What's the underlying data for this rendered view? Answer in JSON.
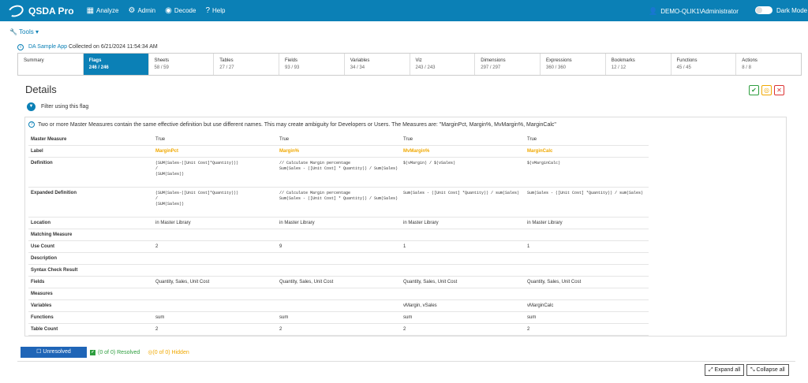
{
  "brand": {
    "title": "QSDA Pro"
  },
  "nav": [
    {
      "label": "Analyze",
      "icon": "grid-icon"
    },
    {
      "label": "Admin",
      "icon": "gear-icon"
    },
    {
      "label": "Decode",
      "icon": "eye-icon"
    },
    {
      "label": "Help",
      "icon": "question-icon"
    }
  ],
  "user": {
    "label": "DEMO-QLIK1\\Administrator"
  },
  "dark_mode": {
    "label": "Dark Mode"
  },
  "tools": {
    "label": "Tools ▾"
  },
  "app": {
    "name": "DA Sample App",
    "collected": " Collected on 6/21/2024 11:54:34 AM"
  },
  "tabs": [
    {
      "name": "Summary",
      "count": ""
    },
    {
      "name": "Flags",
      "count": "246 / 246"
    },
    {
      "name": "Sheets",
      "count": "58 / 59"
    },
    {
      "name": "Tables",
      "count": "27 / 27"
    },
    {
      "name": "Fields",
      "count": "93 / 93"
    },
    {
      "name": "Variables",
      "count": "34 / 34"
    },
    {
      "name": "Viz",
      "count": "243 / 243"
    },
    {
      "name": "Dimensions",
      "count": "297 / 297"
    },
    {
      "name": "Expressions",
      "count": "360 / 360"
    },
    {
      "name": "Bookmarks",
      "count": "12 / 12"
    },
    {
      "name": "Functions",
      "count": "45 / 45"
    },
    {
      "name": "Actions",
      "count": "8 / 8"
    }
  ],
  "details": {
    "title": "Details",
    "filter_label": "Filter using this flag",
    "message": "Two or more Master Measures contain the same effective definition but use different names. This may create ambiguity for Developers or Users. The Measures are: \"MarginPct, Margin%, MvMargin%, MarginCalc\""
  },
  "table": {
    "rows": [
      {
        "label": "Master Measure",
        "cells": [
          "True",
          "True",
          "True",
          "True"
        ]
      },
      {
        "label": "Label",
        "cells": [
          "MarginPct",
          "Margin%",
          "MvMargin%",
          "MarginCalc"
        ]
      },
      {
        "label": "Definition",
        "cells": [
          "(SUM(Sales-([Unit Cost]*Quantity)))\n/\n(SUM(Sales))",
          "// Calculate Margin percentage\nSum(Sales - ([Unit Cost] * Quantity)) / Sum(Sales)",
          "$(vMargin) / $(vSales)",
          "$(vMarginCalc)"
        ]
      },
      {
        "label": "Expanded Definition",
        "cells": [
          "(SUM(Sales-([Unit Cost]*Quantity)))\n/\n(SUM(Sales))",
          "// Calculate Margin percentage\nSum(Sales - ([Unit Cost] * Quantity)) / Sum(Sales)",
          "Sum(Sales - ([Unit Cost] *Quantity)) / sum(Sales)",
          "Sum(Sales - ([Unit Cost] *Quantity)) / sum(Sales)"
        ]
      },
      {
        "label": "Location",
        "cells": [
          "in Master Library",
          "in Master Library",
          "in Master Library",
          "in Master Library"
        ]
      },
      {
        "label": "Matching Measure",
        "cells": [
          "",
          "",
          "",
          ""
        ]
      },
      {
        "label": "Use Count",
        "cells": [
          "2",
          "9",
          "1",
          "1"
        ]
      },
      {
        "label": "Description",
        "cells": [
          "",
          "",
          "",
          ""
        ]
      },
      {
        "label": "Syntax Check Result",
        "cells": [
          "",
          "",
          "",
          ""
        ]
      },
      {
        "label": "Fields",
        "cells": [
          "Quantity, Sales, Unit Cost",
          "Quantity, Sales, Unit Cost",
          "Quantity, Sales, Unit Cost",
          "Quantity, Sales, Unit Cost"
        ]
      },
      {
        "label": "Measures",
        "cells": [
          "",
          "",
          "",
          ""
        ]
      },
      {
        "label": "Variables",
        "cells": [
          "",
          "",
          "vMargin, vSales",
          "vMarginCalc"
        ]
      },
      {
        "label": "Functions",
        "cells": [
          "sum",
          "sum",
          "sum",
          "sum"
        ]
      },
      {
        "label": "Table Count",
        "cells": [
          "2",
          "2",
          "2",
          "2"
        ]
      }
    ]
  },
  "status": {
    "unresolved": "Unresolved",
    "resolved": "(0 of 0) Resolved",
    "hidden": "(0 of 0) Hidden"
  },
  "actions": {
    "expand": "Expand all",
    "collapse": "Collapse all"
  },
  "colors": {
    "primary": "#0b80b6",
    "label": "#f0a800",
    "resolved": "#2e9e3f",
    "unresolved": "#1f65b7"
  }
}
